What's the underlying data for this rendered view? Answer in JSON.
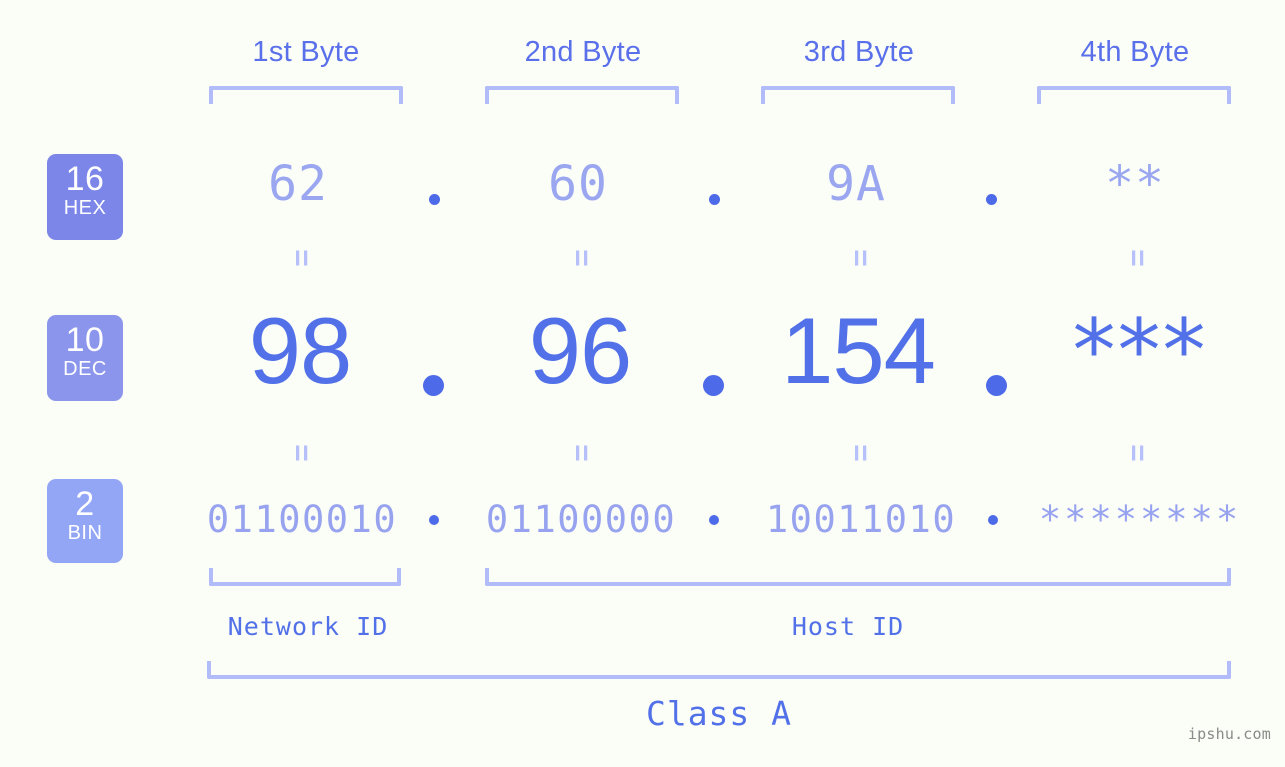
{
  "page": {
    "background_color": "#fbfdf7",
    "watermark": "ipshu.com"
  },
  "colors": {
    "accent_strong": "#5271e8",
    "accent_dot": "#4d6ae8",
    "accent_light": "#9aa6f0",
    "bracket": "#b2bcfa",
    "badge_hex": "#7b86e8",
    "badge_dec": "#8b95ec",
    "badge_bin": "#93a5f5",
    "watermark": "#8a8a8a"
  },
  "byte_headers": [
    {
      "label": "1st Byte"
    },
    {
      "label": "2nd Byte"
    },
    {
      "label": "3rd Byte"
    },
    {
      "label": "4th Byte"
    }
  ],
  "bases": [
    {
      "number": "16",
      "name": "HEX"
    },
    {
      "number": "10",
      "name": "DEC"
    },
    {
      "number": "2",
      "name": "BIN"
    }
  ],
  "rows": {
    "hex": {
      "values": [
        "62",
        "60",
        "9A",
        "**"
      ],
      "separator": "."
    },
    "dec": {
      "values": [
        "98",
        "96",
        "154",
        "***"
      ],
      "separator": "."
    },
    "bin": {
      "values": [
        "01100010",
        "01100000",
        "10011010",
        "********"
      ],
      "separator": "."
    }
  },
  "equals_marker": "=",
  "sections": [
    {
      "label": "Network ID"
    },
    {
      "label": "Host ID"
    }
  ],
  "class": {
    "label": "Class A"
  },
  "ip": {
    "hex_address": "62.60.9A.**",
    "dec_address": "98.96.154.***",
    "bin_address": "01100010.01100000.10011010.********"
  }
}
